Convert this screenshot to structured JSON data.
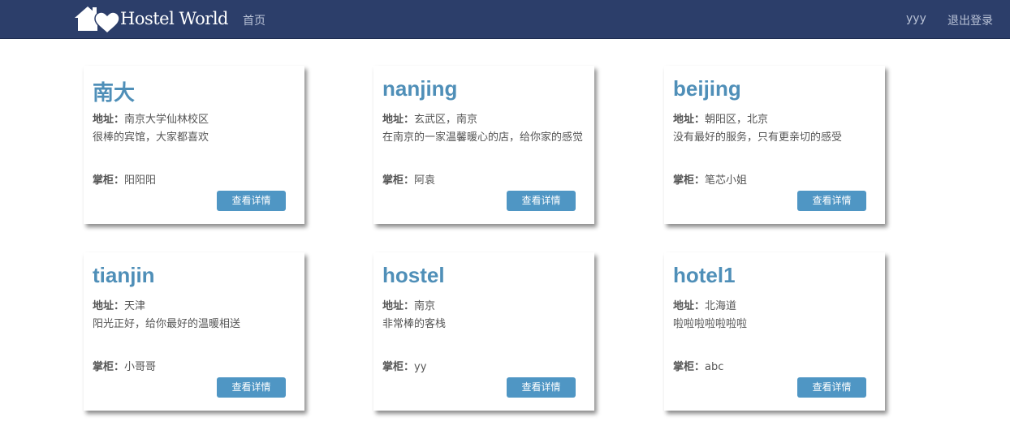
{
  "navbar": {
    "brand": "Hostel World",
    "home_link": "首页",
    "username": "yyy",
    "logout_link": "退出登录"
  },
  "labels": {
    "address": "地址：",
    "owner": "掌柜："
  },
  "hostels": [
    {
      "name": "南大",
      "address": "南京大学仙林校区",
      "description": "很棒的宾馆，大家都喜欢",
      "owner": "阳阳阳",
      "button": "查看详情"
    },
    {
      "name": "nanjing",
      "address": "玄武区，南京",
      "description": "在南京的一家温馨暖心的店，给你家的感觉",
      "owner": "阿袁",
      "button": "查看详情"
    },
    {
      "name": "beijing",
      "address": "朝阳区，北京",
      "description": "没有最好的服务，只有更亲切的感受",
      "owner": "笔芯小姐",
      "button": "查看详情"
    },
    {
      "name": "tianjin",
      "address": "天津",
      "description": "阳光正好，给你最好的温暖相送",
      "owner": "小哥哥",
      "button": "查看详情"
    },
    {
      "name": "hostel",
      "address": "南京",
      "description": "非常棒的客栈",
      "owner": "yy",
      "button": "查看详情"
    },
    {
      "name": "hotel1",
      "address": "北海道",
      "description": "啦啦啦啦啦啦啦",
      "owner": "abc",
      "button": "查看详情"
    }
  ],
  "colors": {
    "navbar_bg": "#2c3e6a",
    "title": "#4f8fb8",
    "button": "#4f96c4"
  }
}
